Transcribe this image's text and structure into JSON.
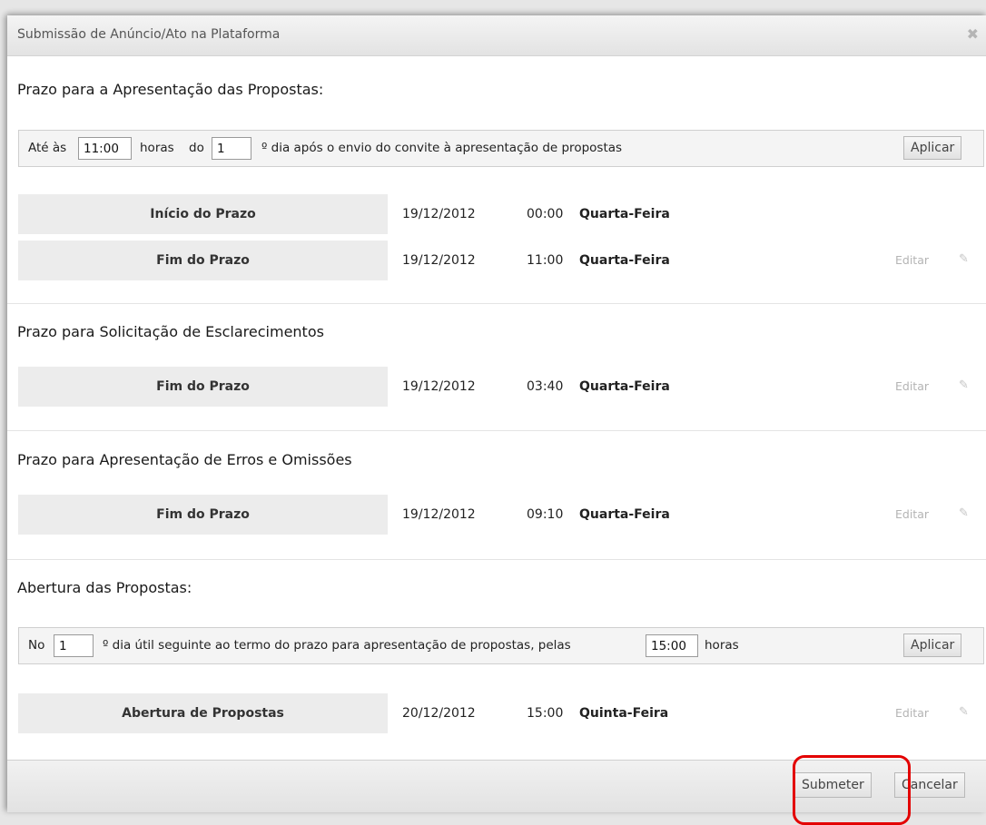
{
  "dialog": {
    "title": "Submissão de Anúncio/Ato na Plataforma",
    "close_icon": "close-icon"
  },
  "section_proposals": {
    "title": "Prazo para a Apresentação das Propostas:",
    "config": {
      "prefix": "Até às",
      "time_value": "11:00",
      "hours_label": "horas",
      "do_label": "do",
      "day_value": "1",
      "suffix": "º dia após o envio do convite à apresentação de propostas",
      "apply_label": "Aplicar"
    },
    "rows": [
      {
        "label": "Início do Prazo",
        "date": "19/12/2012",
        "time": "00:00",
        "weekday": "Quarta-Feira"
      },
      {
        "label": "Fim do Prazo",
        "date": "19/12/2012",
        "time": "11:00",
        "weekday": "Quarta-Feira",
        "edit": "Editar"
      }
    ]
  },
  "section_clarifications": {
    "title": "Prazo para Solicitação de Esclarecimentos",
    "rows": [
      {
        "label": "Fim do Prazo",
        "date": "19/12/2012",
        "time": "03:40",
        "weekday": "Quarta-Feira",
        "edit": "Editar"
      }
    ]
  },
  "section_errors": {
    "title": "Prazo para Apresentação de Erros e Omissões",
    "rows": [
      {
        "label": "Fim do Prazo",
        "date": "19/12/2012",
        "time": "09:10",
        "weekday": "Quarta-Feira",
        "edit": "Editar"
      }
    ]
  },
  "section_opening": {
    "title": "Abertura das Propostas:",
    "config": {
      "prefix": "No",
      "day_value": "1",
      "middle": "º dia útil seguinte ao termo do prazo para apresentação de propostas, pelas",
      "time_value": "15:00",
      "hours_label": "horas",
      "apply_label": "Aplicar"
    },
    "rows": [
      {
        "label": "Abertura de Propostas",
        "date": "20/12/2012",
        "time": "15:00",
        "weekday": "Quinta-Feira",
        "edit": "Editar"
      }
    ]
  },
  "footer": {
    "submit_label": "Submeter",
    "cancel_label": "Cancelar"
  },
  "colors": {
    "highlight": "#e30000",
    "row_label_bg": "#ececec",
    "config_bg": "#f4f4f4"
  }
}
